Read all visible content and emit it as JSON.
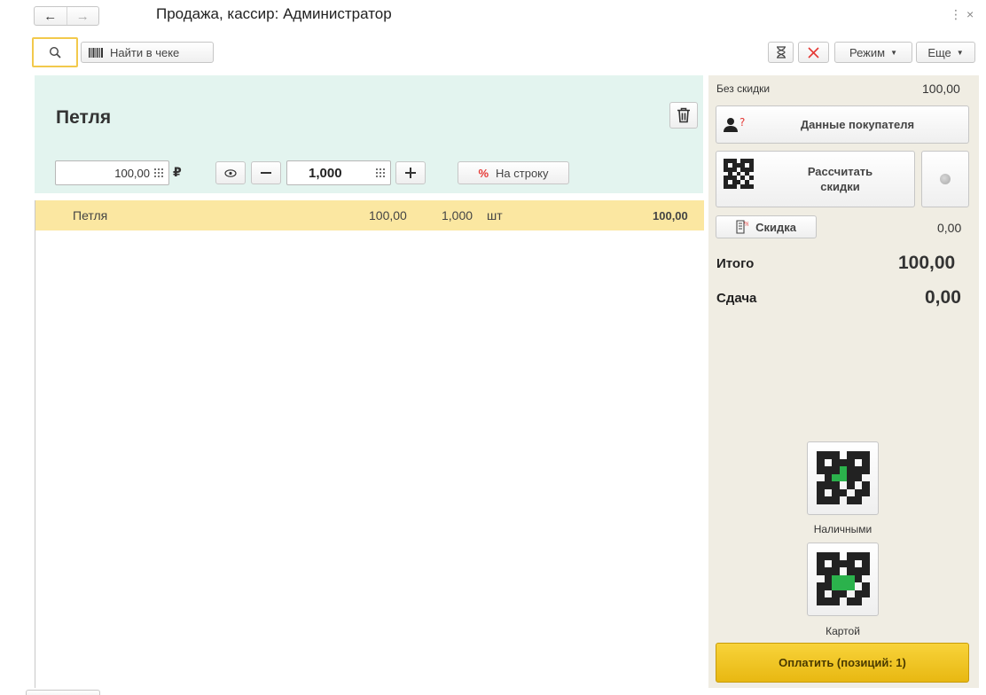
{
  "window": {
    "title": "Продажа, кассир: Администратор",
    "more_glyph": "⋮",
    "close_glyph": "×"
  },
  "toolbar": {
    "find_in_receipt": "Найти в чеке",
    "mode_label": "Режим",
    "more_label": "Еще"
  },
  "product": {
    "name": "Петля",
    "price": "100,00",
    "currency": "₽",
    "quantity": "1,000",
    "per_line_label": "На строку",
    "percent_glyph": "%"
  },
  "receipt": {
    "rows": [
      {
        "name": "Петля",
        "price": "100,00",
        "qty": "1,000",
        "unit": "шт",
        "sum": "100,00"
      }
    ]
  },
  "summary": {
    "no_discount_label": "Без скидки",
    "no_discount_value": "100,00",
    "customer_data_label": "Данные покупателя",
    "calculate_discounts_label": "Рассчитать скидки",
    "discount_label": "Скидка",
    "discount_value": "0,00",
    "total_label": "Итого",
    "total_value": "100,00",
    "change_label": "Сдача",
    "change_value": "0,00"
  },
  "payment": {
    "cash_label": "Наличными",
    "card_label": "Картой",
    "pay_label": "Оплатить (позиций: 1)"
  },
  "colors": {
    "header_bg": "#e3f4ef",
    "selected_row": "#fbe7a1",
    "right_panel_bg": "#f0ede3",
    "pay_button": "#f3c623",
    "search_focus": "#f2c94c",
    "cancel_red": "#e53935"
  },
  "icons": {
    "back": "arrow-left-icon",
    "forward": "arrow-right-icon",
    "search": "search-icon",
    "barcode": "barcode-icon",
    "hourglass": "hourglass-icon",
    "cancel": "x-icon",
    "trash": "trash-icon",
    "eye": "eye-icon",
    "user": "user-question-icon",
    "qr": "qr-code-icon",
    "discount": "discount-doc-icon"
  }
}
